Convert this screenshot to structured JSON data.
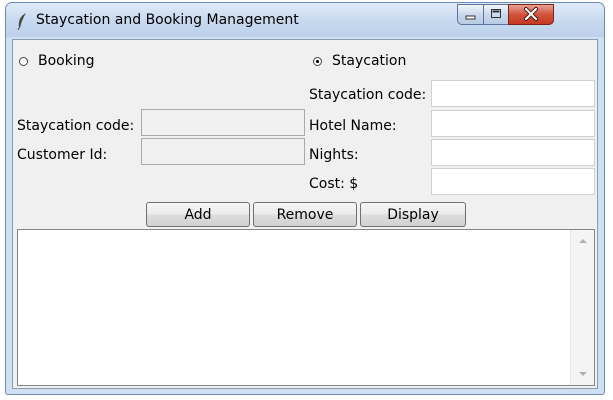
{
  "window": {
    "title": "Staycation and Booking Management",
    "icon": "feather-icon",
    "controls": [
      "minimize-icon",
      "maximize-icon",
      "close-icon"
    ]
  },
  "mode": {
    "booking_label": "Booking",
    "staycation_label": "Staycation",
    "selected": "Staycation"
  },
  "booking_form": {
    "staycation_code_label": "Staycation code:",
    "staycation_code_value": "",
    "customer_id_label": "Customer Id:",
    "customer_id_value": "",
    "enabled": false
  },
  "staycation_form": {
    "staycation_code_label": "Staycation code:",
    "staycation_code_value": "",
    "hotel_name_label": "Hotel Name:",
    "hotel_name_value": "",
    "nights_label": "Nights:",
    "nights_value": "",
    "cost_label": "Cost: $",
    "cost_value": ""
  },
  "buttons": {
    "add_label": "Add",
    "remove_label": "Remove",
    "display_label": "Display"
  },
  "output": {
    "items": []
  }
}
